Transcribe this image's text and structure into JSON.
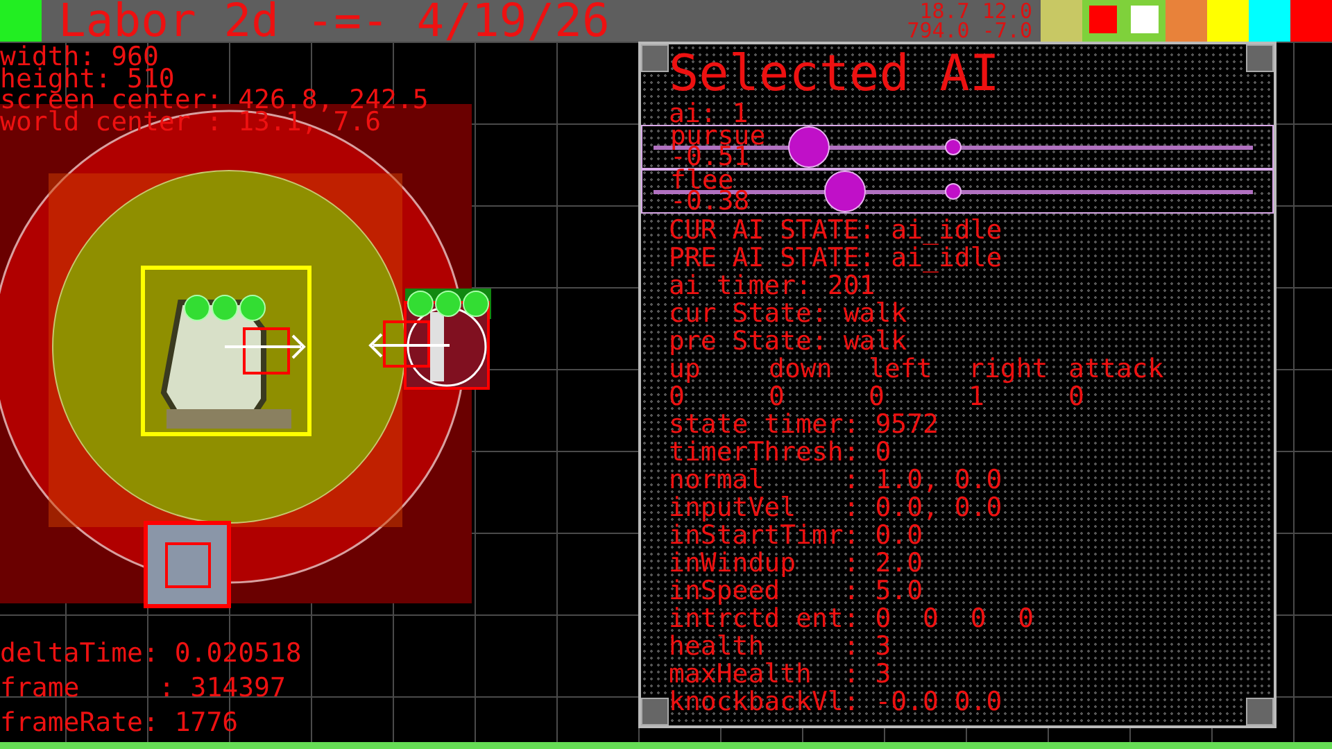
{
  "title": "Labor 2d -=- 4/19/26",
  "palette": [
    {
      "color": "#c8c864"
    },
    {
      "color": "#7fd13b"
    },
    {
      "color": "#e8823a"
    },
    {
      "color": "#ffff00"
    },
    {
      "color": "#00ffff"
    },
    {
      "color": "#ff0000"
    }
  ],
  "primary_color": {
    "color": "#ff0000"
  },
  "secondary_color": {
    "color": "#ffffff"
  },
  "cursor_readout": [
    "18.7 12.0",
    "794.0 -7.0"
  ],
  "debug_info": [
    "width: 960",
    "height: 510",
    "screen center: 426.8, 242.5",
    "world center : 13.1, 7.6"
  ],
  "frame_stats": [
    "deltaTime: 0.020518",
    "frame     : 314397",
    "frameRate: 1776"
  ],
  "panel": {
    "title": "Selected AI",
    "ai": "ai: 1",
    "sliders": [
      {
        "label": "pursue",
        "level": 0.26,
        "reading": "-0.51"
      },
      {
        "label": "flee",
        "level": 0.32,
        "reading": "-0.38"
      }
    ],
    "lines_top": [
      "CUR AI STATE: ai_idle",
      "PRE AI STATE: ai_idle",
      "ai timer: 201",
      "cur State: walk",
      "pre State: walk"
    ],
    "inputs": {
      "headers": [
        "up",
        "down",
        "left",
        "right",
        "attack"
      ],
      "values": [
        "0",
        "0",
        "0",
        "1",
        "0"
      ]
    },
    "lines_bottom": [
      "state timer: 9572",
      "timerThresh: 0",
      "normal     : 1.0, 0.0",
      "inputVel   : 0.0, 0.0",
      "inStartTimr: 0.0",
      "inWindup   : 2.0",
      "inSpeed    : 5.0",
      "intrctd ent: 0  0  0  0",
      "health     : 3",
      "maxHealth  : 3",
      "knockbackVl: -0.0 0.0"
    ]
  }
}
